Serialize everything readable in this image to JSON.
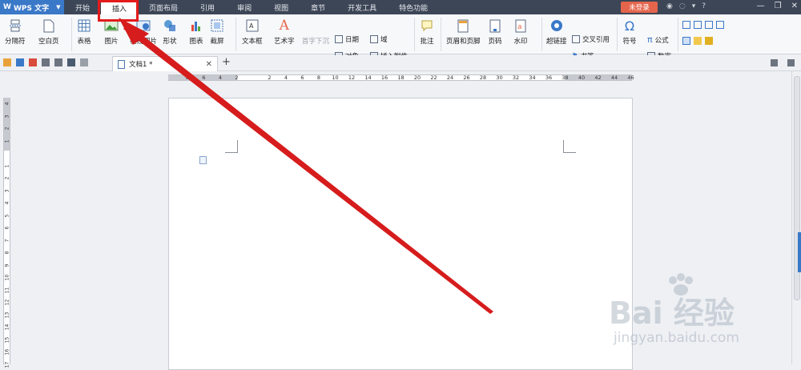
{
  "app": {
    "name": "WPS 文字"
  },
  "menu_tabs": [
    "开始",
    "插入",
    "页面布局",
    "引用",
    "审阅",
    "视图",
    "章节",
    "开发工具",
    "特色功能"
  ],
  "active_tab": "插入",
  "login_label": "未登录",
  "ribbon": {
    "page_break": "分隔符",
    "blank_page": "空白页",
    "table": "表格",
    "picture": "图片",
    "online_picture": "在线图片",
    "shape": "形状",
    "chart": "图表",
    "screenshot": "截屏",
    "textbox": "文本框",
    "wordart": "艺术字",
    "drop_cap": "首字下沉",
    "date": "日期",
    "object": "对象",
    "field": "域",
    "attachment": "插入附件",
    "comment": "批注",
    "header_footer": "页眉和页脚",
    "page_number": "页码",
    "watermark": "水印",
    "hyperlink": "超链接",
    "cross_ref": "交叉引用",
    "bookmark": "书签",
    "symbol": "符号",
    "formula": "公式",
    "number": "数字"
  },
  "document": {
    "tab_title": "文档1 *"
  },
  "ruler_h": [
    "8",
    "6",
    "4",
    "2",
    "",
    "2",
    "4",
    "6",
    "8",
    "10",
    "12",
    "14",
    "16",
    "18",
    "20",
    "22",
    "24",
    "26",
    "28",
    "30",
    "32",
    "34",
    "36",
    "38",
    "40",
    "42",
    "44",
    "46"
  ],
  "ruler_v": [
    "4",
    "3",
    "2",
    "1",
    "",
    "1",
    "2",
    "3",
    "4",
    "5",
    "6",
    "7",
    "8",
    "9",
    "10",
    "11",
    "12",
    "13",
    "14",
    "15",
    "16",
    "17"
  ],
  "watermark": {
    "main": "Bai 经验",
    "sub": "jingyan.baidu.com"
  },
  "colors": {
    "accent": "#3a78c8",
    "titlebar": "#3c4656",
    "highlight": "#e31b1b",
    "login": "#e5654c"
  }
}
